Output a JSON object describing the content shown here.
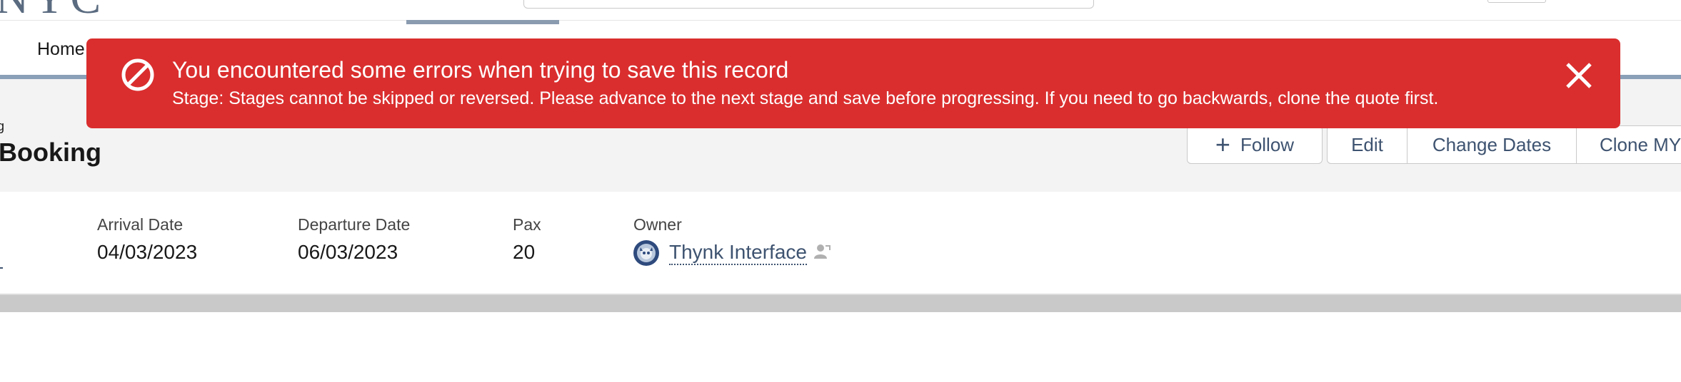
{
  "header": {
    "logo_fragment": "NYC",
    "search_placeholder": ""
  },
  "nav": {
    "home_label": "Home"
  },
  "record": {
    "title_fragment": "g",
    "title": "Booking",
    "actions": {
      "follow_label": "Follow",
      "edit_label": "Edit",
      "change_dates_label": "Change Dates",
      "clone_label": "Clone MY"
    }
  },
  "highlights": {
    "fields": [
      {
        "label": "Arrival Date",
        "value": "04/03/2023"
      },
      {
        "label": "Departure Date",
        "value": "06/03/2023"
      },
      {
        "label": "Pax",
        "value": "20"
      }
    ],
    "owner": {
      "label": "Owner",
      "name": "Thynk Interface"
    }
  },
  "toast": {
    "title": "You encountered some errors when trying to save this record",
    "message": "Stage: Stages cannot be skipped or reversed. Please advance to the next stage and save before progressing. If you need to go backwards, clone the quote first.",
    "color": "#da2e2e",
    "icons": {
      "status": "error-ban-icon",
      "close": "close-icon"
    }
  },
  "colors": {
    "link": "#3e5370",
    "header_bg": "#f3f3f3",
    "nav_accent": "#8aa0b8"
  }
}
